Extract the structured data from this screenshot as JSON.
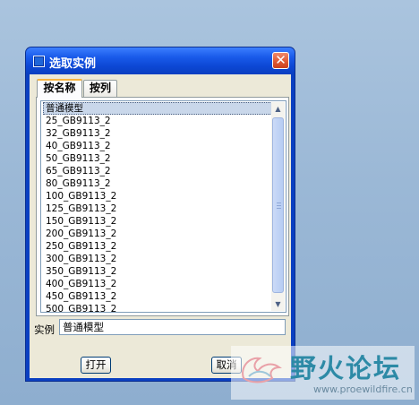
{
  "window": {
    "title": "选取实例",
    "close_glyph": "✕"
  },
  "tabs": [
    {
      "label": "按名称",
      "active": true
    },
    {
      "label": "按列",
      "active": false
    }
  ],
  "list": {
    "items": [
      "普通模型",
      "25_GB9113_2",
      "32_GB9113_2",
      "40_GB9113_2",
      "50_GB9113_2",
      "65_GB9113_2",
      "80_GB9113_2",
      "100_GB9113_2",
      "125_GB9113_2",
      "150_GB9113_2",
      "200_GB9113_2",
      "250_GB9113_2",
      "300_GB9113_2",
      "350_GB9113_2",
      "400_GB9113_2",
      "450_GB9113_2",
      "500_GB9113_2"
    ],
    "selected_index": 0
  },
  "instance": {
    "label": "实例",
    "value": "普通模型"
  },
  "buttons": {
    "open_label": "打开",
    "cancel_label": "取消"
  },
  "watermark": {
    "title": "野火论坛",
    "url": "www.proewildfire.cn"
  },
  "colors": {
    "titlebar": "#0a3fc1",
    "selection": "#c9d7ea",
    "close_button": "#e05a35"
  }
}
